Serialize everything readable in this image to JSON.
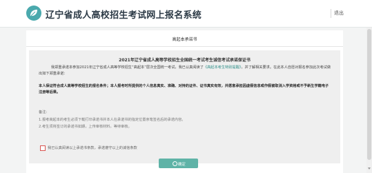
{
  "header": {
    "site_title": "辽宁省成人高校招生考试网上报名系统",
    "logout_label": "退出",
    "logo_icon": "leaf-logo-icon"
  },
  "card": {
    "title": "高起本承诺书"
  },
  "notice": {
    "heading": "2021年辽宁省成人高等学校招生全国统一考试考生诚信考试承诺保证书",
    "para1_before": "我郑重承诺本参加2021年辽宁省成人高等学校招生“高起本”层次全国统一考试，我已认真阅读了",
    "para1_link": "《高起本考生特别提醒》",
    "para1_after": "，并了解相关要求。在此本人自愿对报名参加此次考试做出如下郑重承诺：",
    "para2": "本人保证符合成人高等学校招生的报名条件；本人报考时所提供的个人信息真实、准确、对持的证件、证书真实有效，并愿意承担因虚假信息或作假被取消入学资格或不予新生学籍电子注册等后果。",
    "remark_label": "备注:",
    "remark_1": "1.报考高起本的考生必须下载打印承诺书并本人在承诺书的指定位置亲笔签名后的承诺内容。",
    "remark_2": "2.考生须将签订的承诺书如期，上传审核材料，等待审核。"
  },
  "agreement": {
    "label": "我已认真阅读以上承诺书条款，承诺遵守以上的诚信条款"
  },
  "confirm_button": {
    "label": "确定"
  },
  "colors": {
    "accent": "#5fb3a7",
    "link": "#2f8f88",
    "checkbox_border": "#d9534f"
  }
}
